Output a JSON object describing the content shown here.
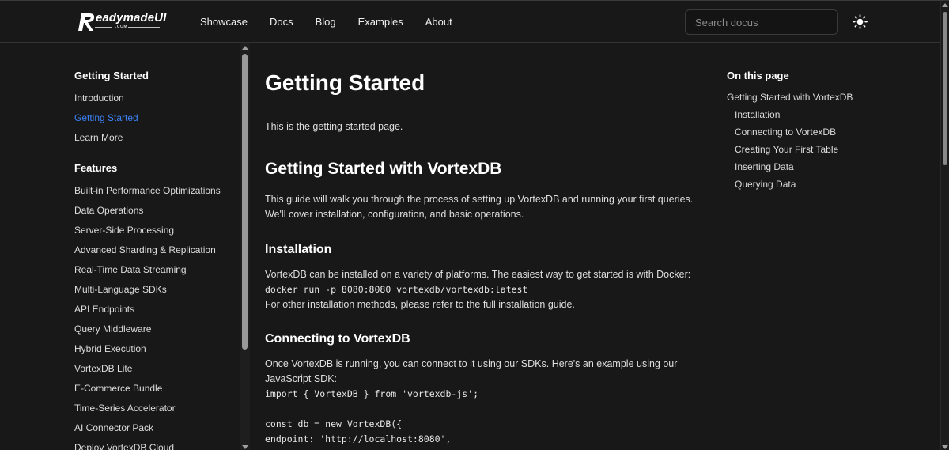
{
  "header": {
    "logo_text": "eadymadeUI",
    "logo_sub": ".COM",
    "nav": [
      "Showcase",
      "Docs",
      "Blog",
      "Examples",
      "About"
    ],
    "search_placeholder": "Search docus"
  },
  "sidebar": {
    "sections": [
      {
        "title": "Getting Started",
        "items": [
          "Introduction",
          "Getting Started",
          "Learn More"
        ]
      },
      {
        "title": "Features",
        "items": [
          "Built-in Performance Optimizations",
          "Data Operations",
          "Server-Side Processing",
          "Advanced Sharding & Replication",
          "Real-Time Data Streaming",
          "Multi-Language SDKs",
          "API Endpoints",
          "Query Middleware",
          "Hybrid Execution",
          "VortexDB Lite",
          "E-Commerce Bundle",
          "Time-Series Accelerator",
          "AI Connector Pack",
          "Deploy VortexDB Cloud"
        ]
      }
    ],
    "active_item": "Getting Started"
  },
  "main": {
    "title": "Getting Started",
    "intro": "This is the getting started page.",
    "h2": "Getting Started with VortexDB",
    "guide_p1": "This guide will walk you through the process of setting up VortexDB and running your first queries.",
    "guide_p2": "We'll cover installation, configuration, and basic operations.",
    "install_title": "Installation",
    "install_p": "VortexDB can be installed on a variety of platforms. The easiest way to get started is with Docker:",
    "install_code": "docker run -p 8080:8080 vortexdb/vortexdb:latest",
    "install_p2": "For other installation methods, please refer to the full installation guide.",
    "connect_title": "Connecting to VortexDB",
    "connect_p1": "Once VortexDB is running, you can connect to it using our SDKs. Here's an example using our",
    "connect_p2": "JavaScript SDK:",
    "code_l1": "import { VortexDB } from 'vortexdb-js';",
    "code_l2": "const db = new VortexDB({",
    "code_l3": "endpoint: 'http://localhost:8080',"
  },
  "toc": {
    "title": "On this page",
    "items": [
      "Getting Started with VortexDB",
      "Installation",
      "Connecting to VortexDB",
      "Creating Your First Table",
      "Inserting Data",
      "Querying Data"
    ]
  },
  "colors": {
    "background": "#181818",
    "accent": "#3b82f6",
    "text": "#e6e6e6"
  }
}
